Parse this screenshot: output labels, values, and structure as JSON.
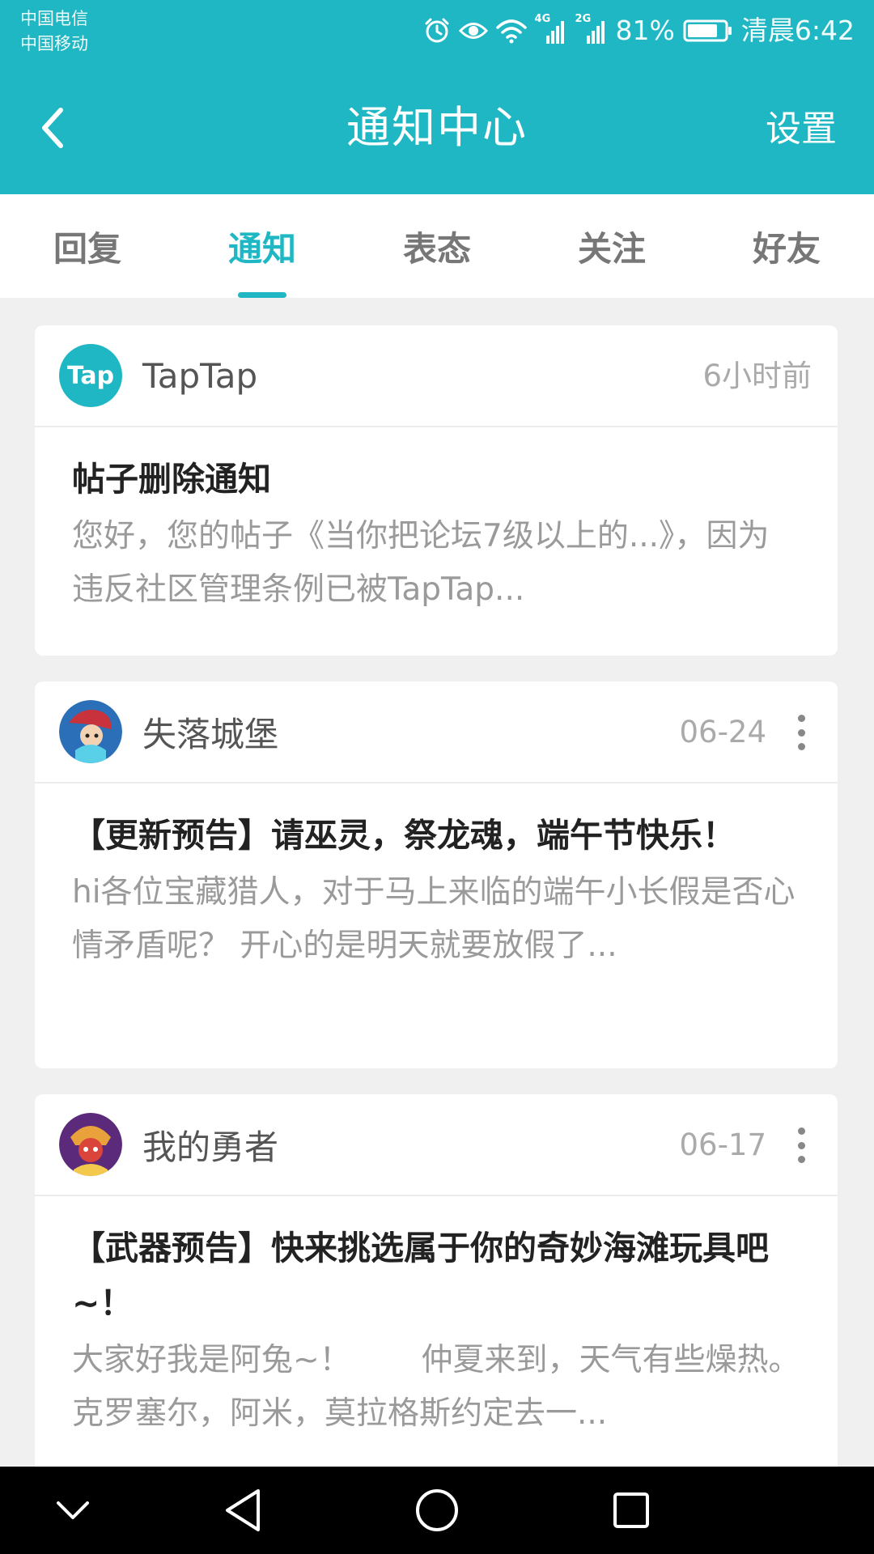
{
  "status_bar": {
    "carrier_1": "中国电信",
    "carrier_2": "中国移动",
    "network_1": "4G",
    "network_2": "2G",
    "battery": "81%",
    "time": "清晨6:42",
    "icons": [
      "alarm-icon",
      "eye-icon",
      "wifi-icon",
      "signal-icon",
      "signal-icon",
      "battery-icon"
    ]
  },
  "header": {
    "title": "通知中心",
    "settings_label": "设置",
    "back_icon": "chevron-left-icon"
  },
  "tabs": [
    {
      "label": "回复",
      "active": false
    },
    {
      "label": "通知",
      "active": true
    },
    {
      "label": "表态",
      "active": false
    },
    {
      "label": "关注",
      "active": false
    },
    {
      "label": "好友",
      "active": false
    }
  ],
  "notifications": [
    {
      "author": "TapTap",
      "avatar_text": "Tap",
      "time": "6小时前",
      "title": "帖子删除通知",
      "text": "您好，您的帖子《当你把论坛7级以上的...》，因为违反社区管理条例已被TapTap...",
      "has_more": false
    },
    {
      "author": "失落城堡",
      "time": "06-24",
      "title": "【更新预告】请巫灵，祭龙魂，端午节快乐！",
      "text": "hi各位宝藏猎人，对于马上来临的端午小长假是否心情矛盾呢？ 开心的是明天就要放假了...",
      "has_more": true
    },
    {
      "author": "我的勇者",
      "time": "06-17",
      "title": "【武器预告】快来挑选属于你的奇妙海滩玩具吧~！",
      "text": "大家好我是阿兔~！       仲夏来到，天气有些燥热。克罗塞尔，阿米，莫拉格斯约定去一...",
      "has_more": true
    }
  ],
  "colors": {
    "brand": "#1fb7c3",
    "background": "#f0f0f0",
    "title_text": "#222222",
    "body_text": "#9a9a9a"
  },
  "system_nav": {
    "icons": [
      "chevron-down-icon",
      "back-triangle-icon",
      "home-circle-icon",
      "recents-square-icon"
    ]
  }
}
